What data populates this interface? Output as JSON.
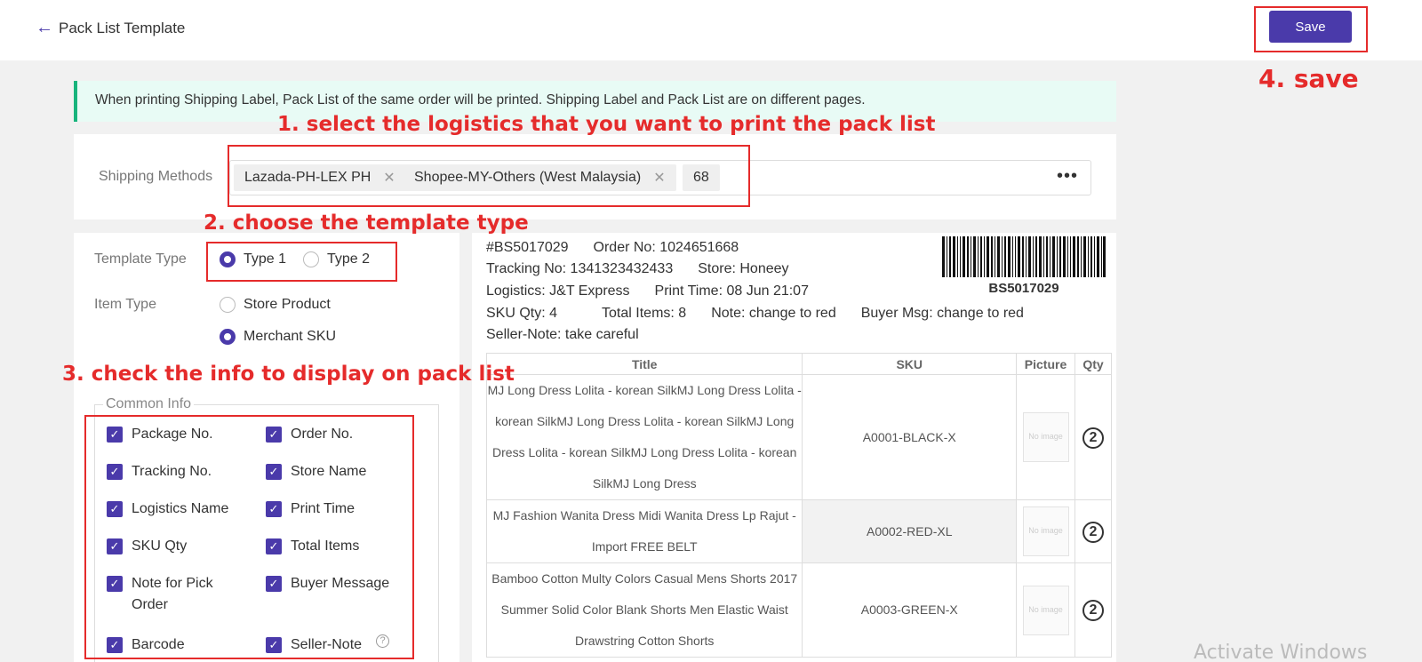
{
  "header": {
    "back_icon": "arrow-left-icon",
    "title": "Pack List Template",
    "save_label": "Save"
  },
  "notice": "When printing Shipping Label, Pack List of the same order will be printed. Shipping Label and Pack List are on different pages.",
  "shipping": {
    "label": "Shipping Methods",
    "tags": [
      "Lazada-PH-LEX PH",
      "Shopee-MY-Others (West Malaysia)"
    ],
    "more_count": "68",
    "more_icon": "ellipsis-icon"
  },
  "template": {
    "type_label": "Template Type",
    "type_options": [
      "Type 1",
      "Type 2"
    ],
    "type_selected": "Type 1",
    "item_type_label": "Item Type",
    "item_type_options": [
      "Store Product",
      "Merchant SKU"
    ],
    "item_type_selected": "Merchant SKU"
  },
  "common_info": {
    "legend": "Common Info",
    "checkboxes": [
      {
        "label": "Package No.",
        "checked": true
      },
      {
        "label": "Order No.",
        "checked": true
      },
      {
        "label": "Tracking No.",
        "checked": true
      },
      {
        "label": "Store Name",
        "checked": true
      },
      {
        "label": "Logistics Name",
        "checked": true
      },
      {
        "label": "Print Time",
        "checked": true
      },
      {
        "label": "SKU Qty",
        "checked": true
      },
      {
        "label": "Total Items",
        "checked": true
      },
      {
        "label": "Note for Pick Order",
        "checked": true
      },
      {
        "label": "Buyer Message",
        "checked": true
      },
      {
        "label": "Barcode",
        "checked": true
      },
      {
        "label": "Seller-Note",
        "checked": true
      }
    ]
  },
  "preview": {
    "package_no": "#BS5017029",
    "order_no": "Order No: 1024651668",
    "tracking": "Tracking No: 1341323432433",
    "store": "Store: Honeey",
    "logistics": "Logistics: J&T Express",
    "print_time": "Print Time: 08 Jun 21:07",
    "sku_qty": "SKU Qty: 4",
    "total_items": "Total Items: 8",
    "note": "Note: change to red",
    "buyer_msg": "Buyer Msg: change to red",
    "seller_note": "Seller-Note: take careful",
    "barcode_text": "BS5017029",
    "columns": [
      "Title",
      "SKU",
      "Picture",
      "Qty"
    ],
    "rows": [
      {
        "title": "MJ Long Dress Lolita - korean SilkMJ Long Dress Lolita - korean SilkMJ Long Dress Lolita - korean SilkMJ Long Dress Lolita - korean SilkMJ Long Dress Lolita - korean SilkMJ Long Dress",
        "sku": "A0001-BLACK-X",
        "picture": "No image",
        "qty": "2"
      },
      {
        "title": "MJ Fashion Wanita Dress Midi Wanita Dress Lp Rajut - Import FREE BELT",
        "sku": "A0002-RED-XL",
        "picture": "No image",
        "qty": "2"
      },
      {
        "title": "Bamboo Cotton Multy Colors Casual Mens Shorts 2017 Summer Solid Color Blank Shorts Men Elastic Waist Drawstring Cotton Shorts",
        "sku": "A0003-GREEN-X",
        "picture": "No image",
        "qty": "2"
      }
    ]
  },
  "annotations": {
    "step1": "1. select the logistics that you want to print the pack list",
    "step2": "2. choose the template type",
    "step3": "3. check the info to display on pack list",
    "step4": "4. save"
  },
  "watermark": "Activate Windows",
  "colors": {
    "accent": "#4a3aaa",
    "annotation": "#e52b2b",
    "notice_bg": "#e8fbf5",
    "notice_border": "#18b47c"
  }
}
